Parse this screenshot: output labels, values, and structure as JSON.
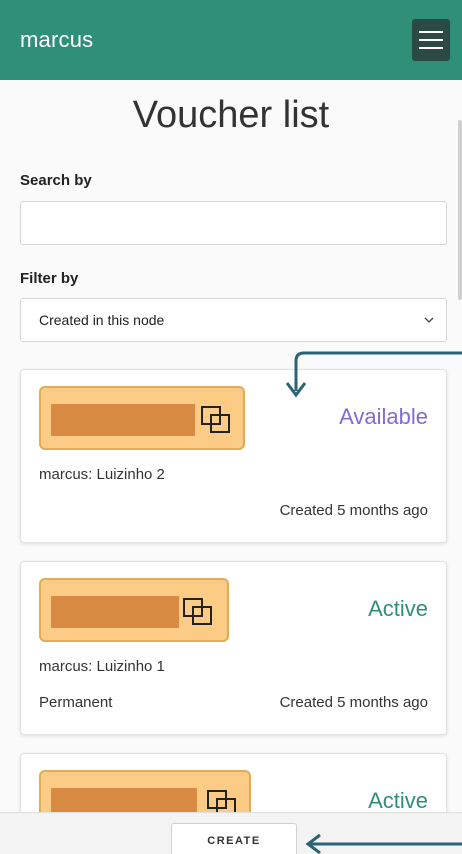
{
  "app": {
    "name": "marcus"
  },
  "page": {
    "title": "Voucher list"
  },
  "search": {
    "label": "Search by",
    "value": "",
    "placeholder": ""
  },
  "filter": {
    "label": "Filter by",
    "selected": "Created in this node"
  },
  "vouchers": [
    {
      "status": "Available",
      "status_color": "#7b6fd6",
      "owner": "marcus: Luizinho 2",
      "duration": "",
      "created": "Created 5 months ago"
    },
    {
      "status": "Active",
      "status_color": "#2f8f79",
      "owner": "marcus: Luizinho 1",
      "duration": "Permanent",
      "created": "Created 5 months ago"
    },
    {
      "status": "Active",
      "status_color": "#2f8f79",
      "owner": "",
      "duration": "",
      "created": ""
    }
  ],
  "footer": {
    "create_label": "CREATE"
  },
  "colors": {
    "primary": "#2f8f79",
    "voucher_bg": "#fccb85",
    "voucher_redaction": "#d88b43"
  },
  "icons": {
    "menu": "hamburger-icon",
    "copy": "copy-icon",
    "dropdown": "chevron-down-icon"
  }
}
